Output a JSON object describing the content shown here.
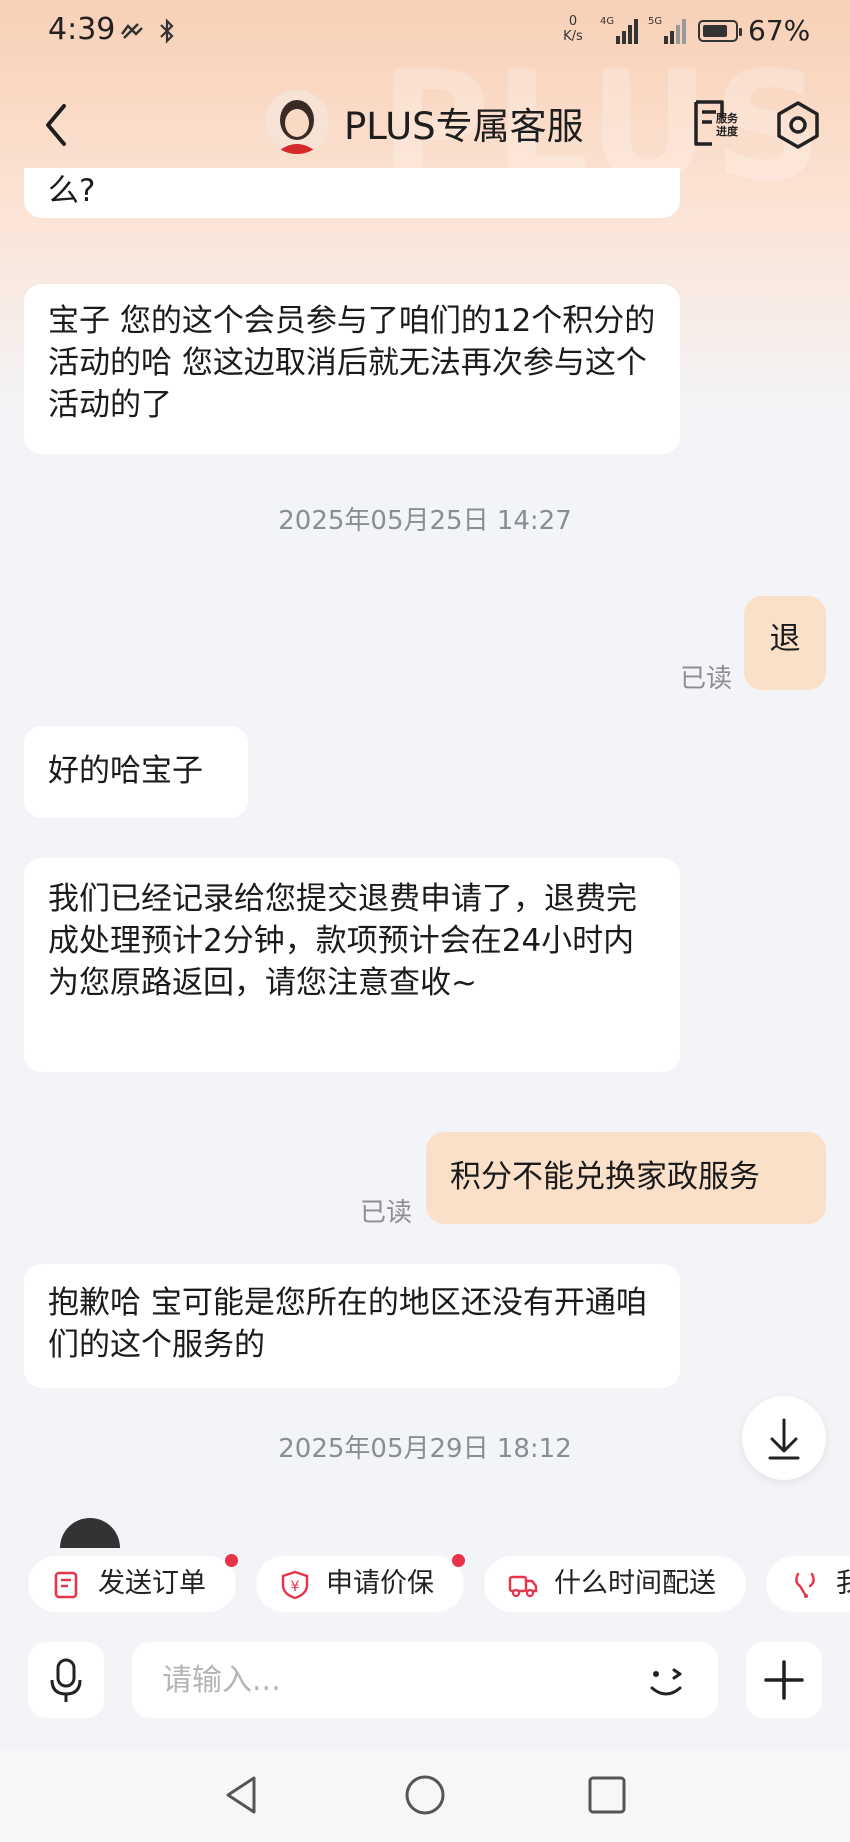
{
  "status_bar": {
    "time": "4:39",
    "net_speed_value": "0",
    "net_speed_unit": "K/s",
    "sig1_label": "4G",
    "sig2_label": "5G",
    "battery": "67%"
  },
  "header": {
    "title": "PLUS专属客服",
    "watermark": "PLUS",
    "service_line1": "服务",
    "service_line2": "进度"
  },
  "messages": [
    {
      "dir": "in",
      "text": "么?"
    },
    {
      "dir": "in",
      "text": "宝子 您的这个会员参与了咱们的12个积分的活动的哈 您这边取消后就无法再次参与这个活动的了"
    },
    {
      "dir": "ts",
      "text": "2025年05月25日 14:27"
    },
    {
      "dir": "out",
      "text": "退",
      "status": "已读"
    },
    {
      "dir": "in",
      "text": "好的哈宝子"
    },
    {
      "dir": "in",
      "text": "我们已经记录给您提交退费申请了，退费完成处理预计2分钟，款项预计会在24小时内为您原路返回，请您注意查收~"
    },
    {
      "dir": "out",
      "text": "积分不能兑换家政服务",
      "status": "已读"
    },
    {
      "dir": "in",
      "text": "抱歉哈 宝可能是您所在的地区还没有开通咱们的这个服务的"
    },
    {
      "dir": "ts",
      "text": "2025年05月29日 18:12"
    }
  ],
  "quick_actions": [
    {
      "label": "发送订单",
      "icon": "order-icon"
    },
    {
      "label": "申请价保",
      "icon": "price-protect-icon"
    },
    {
      "label": "什么时间配送",
      "icon": "delivery-truck-icon"
    },
    {
      "label": "我",
      "icon": "repair-icon"
    }
  ],
  "input": {
    "placeholder": "请输入..."
  },
  "colors": {
    "accent": "#e8334a",
    "bubble_out": "#fbe0c9",
    "header_bg": "#f8d0b6"
  }
}
